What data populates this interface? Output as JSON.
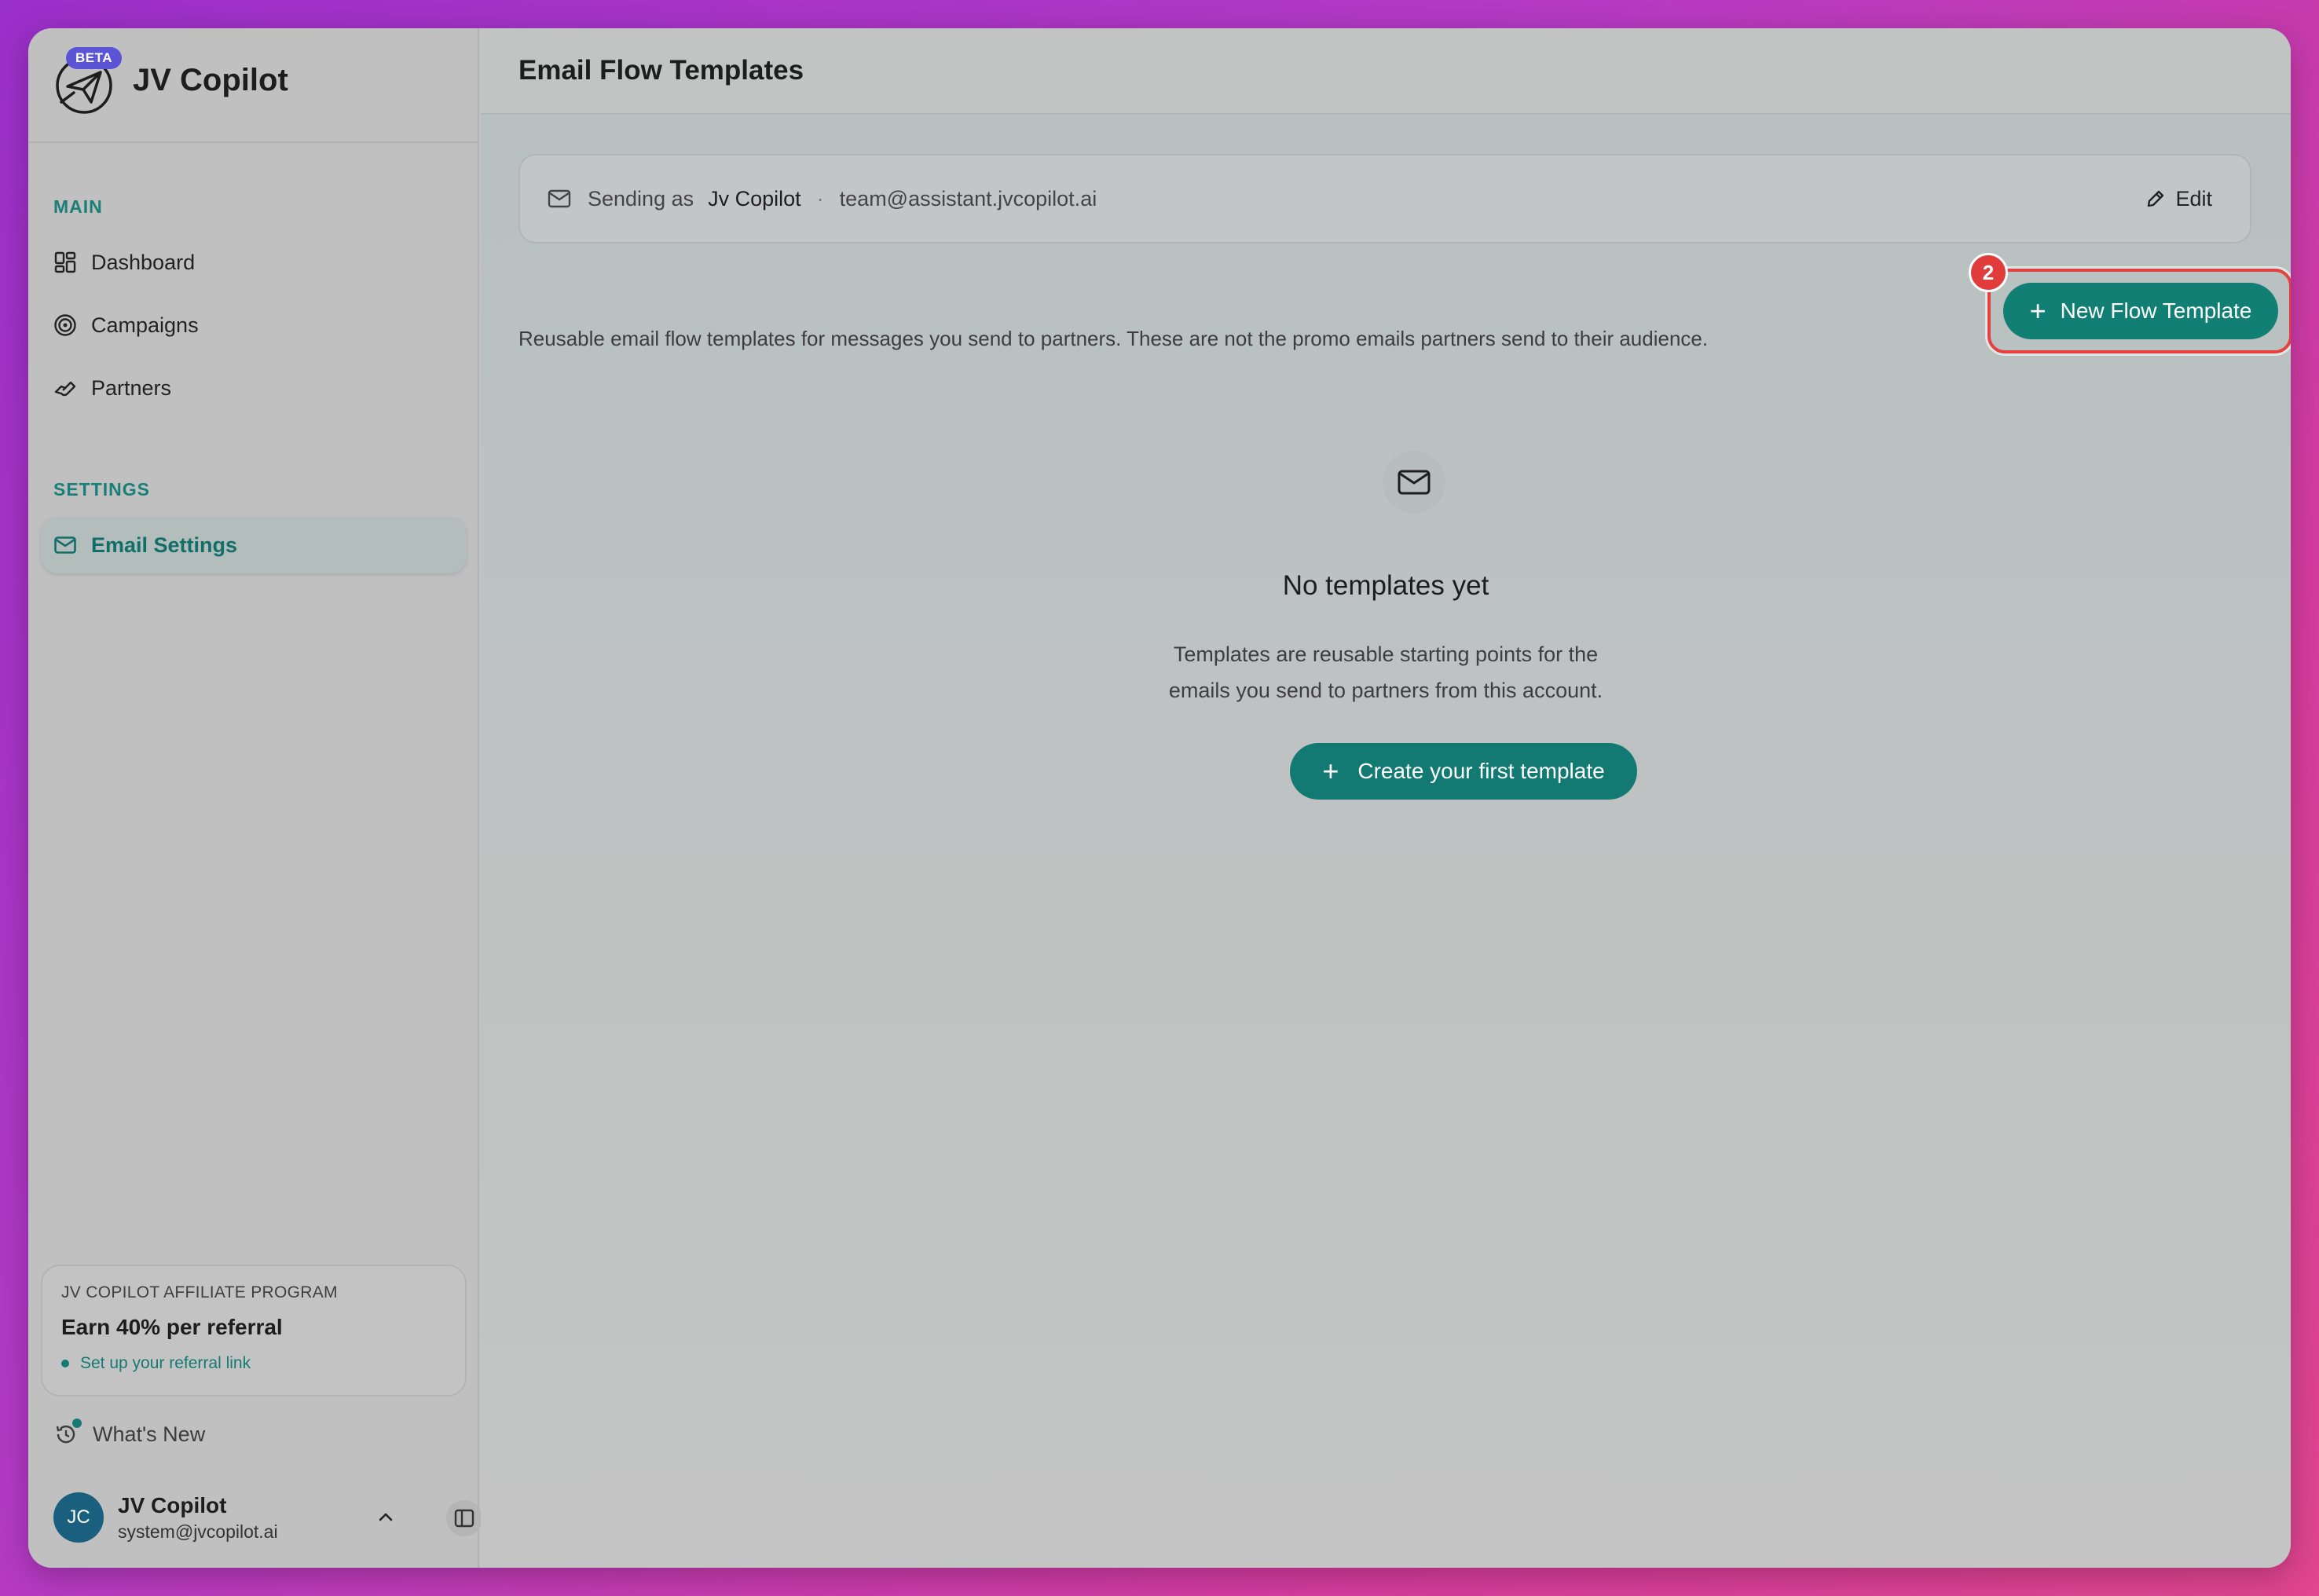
{
  "brand": {
    "name": "JV Copilot",
    "badge": "BETA"
  },
  "sidebar": {
    "sections": [
      {
        "title": "MAIN"
      },
      {
        "title": "SETTINGS"
      }
    ],
    "items": [
      {
        "label": "Dashboard",
        "icon": "dashboard-icon"
      },
      {
        "label": "Campaigns",
        "icon": "target-icon"
      },
      {
        "label": "Partners",
        "icon": "handshake-icon"
      },
      {
        "label": "Email Settings",
        "icon": "mail-icon",
        "active": true
      }
    ],
    "affiliate": {
      "title": "JV COPILOT AFFILIATE PROGRAM",
      "headline": "Earn 40% per referral",
      "link": "Set up your referral link"
    },
    "whats_new": "What's New",
    "user": {
      "initials": "JC",
      "name": "JV Copilot",
      "email": "system@jvcopilot.ai"
    }
  },
  "main": {
    "title": "Email Flow Templates",
    "sender": {
      "prefix": "Sending as",
      "name": "Jv Copilot",
      "separator": "·",
      "email": "team@assistant.jvcopilot.ai",
      "edit_label": "Edit"
    },
    "description": "Reusable email flow templates for messages you send to partners. These are not the promo emails partners send to their audience.",
    "new_button": "New Flow Template",
    "annotation_number": "2",
    "empty": {
      "title": "No templates yet",
      "line1": "Templates are reusable starting points for the",
      "line2": "emails you send to partners from this account.",
      "create_button": "Create your first template"
    }
  },
  "colors": {
    "accent": "#127f75",
    "highlight": "#e53f3f",
    "beta": "#5b54d6"
  }
}
